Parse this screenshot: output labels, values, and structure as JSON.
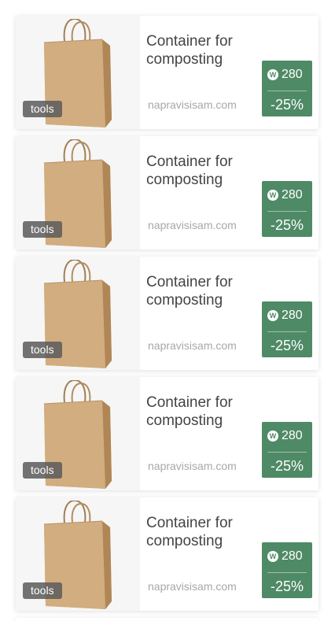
{
  "items": [
    {
      "tag": "tools",
      "title": "Container for composting",
      "source": "napravisisam.com",
      "points": "280",
      "coin_symbol": "W",
      "discount": "-25%"
    },
    {
      "tag": "tools",
      "title": "Container for composting",
      "source": "napravisisam.com",
      "points": "280",
      "coin_symbol": "W",
      "discount": "-25%"
    },
    {
      "tag": "tools",
      "title": "Container for composting",
      "source": "napravisisam.com",
      "points": "280",
      "coin_symbol": "W",
      "discount": "-25%"
    },
    {
      "tag": "tools",
      "title": "Container for composting",
      "source": "napravisisam.com",
      "points": "280",
      "coin_symbol": "W",
      "discount": "-25%"
    },
    {
      "tag": "tools",
      "title": "Container for composting",
      "source": "napravisisam.com",
      "points": "280",
      "coin_symbol": "W",
      "discount": "-25%"
    }
  ],
  "colors": {
    "price_box": "#4f8a66",
    "tag_bg": "#5a5a5a",
    "title": "#444444",
    "source": "#a8a8a8"
  },
  "icons": {
    "product_image": "paper-bag-icon",
    "coin": "coin-icon"
  }
}
